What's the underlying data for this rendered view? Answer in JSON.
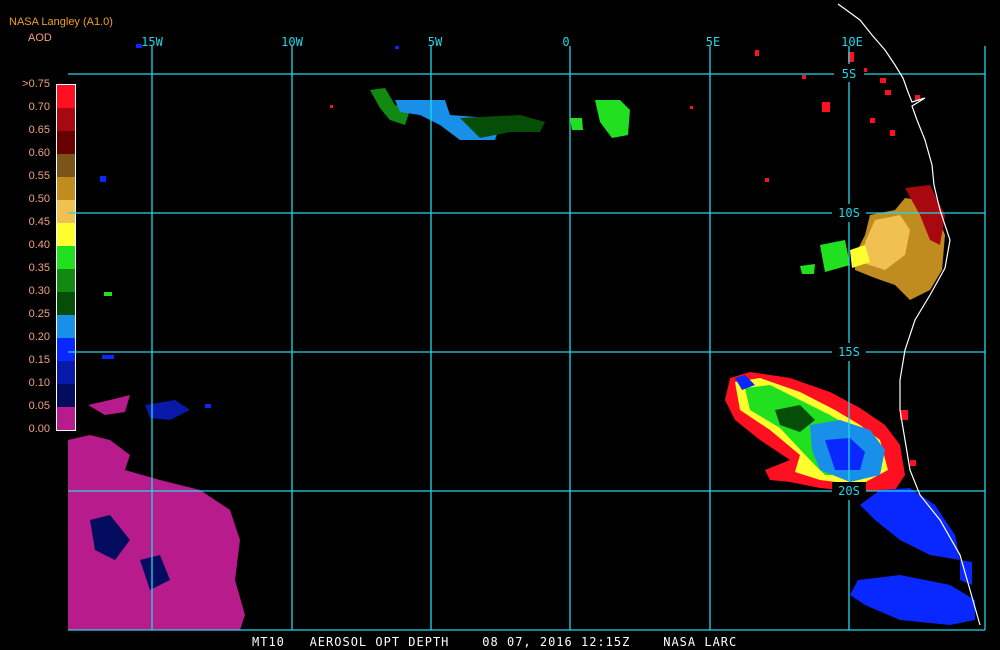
{
  "header": {
    "title": "NASA Langley (A1.0)",
    "subtitle": "AOD"
  },
  "legend": {
    "labels": [
      ">0.75",
      "0.70",
      "0.65",
      "0.60",
      "0.55",
      "0.50",
      "0.45",
      "0.40",
      "0.35",
      "0.30",
      "0.25",
      "0.20",
      "0.15",
      "0.10",
      "0.05",
      "0.00"
    ],
    "colors": [
      "#ff1020",
      "#a80810",
      "#680000",
      "#7a5418",
      "#c08c20",
      "#f0c050",
      "#ffff30",
      "#20e020",
      "#128a12",
      "#064e08",
      "#1890ea",
      "#0828ff",
      "#0818a8",
      "#040c60",
      "#b81c8c"
    ]
  },
  "map": {
    "lon_labels": [
      "15W",
      "10W",
      "5W",
      "0",
      "5E",
      "10E"
    ],
    "lat_labels": [
      "5S",
      "10S",
      "15S",
      "20S"
    ],
    "coastline_color": "#ffffff",
    "grid_color": "#22d8e8"
  },
  "caption": "MT10   AEROSOL OPT DEPTH    08 07, 2016 12:15Z    NASA LARC"
}
